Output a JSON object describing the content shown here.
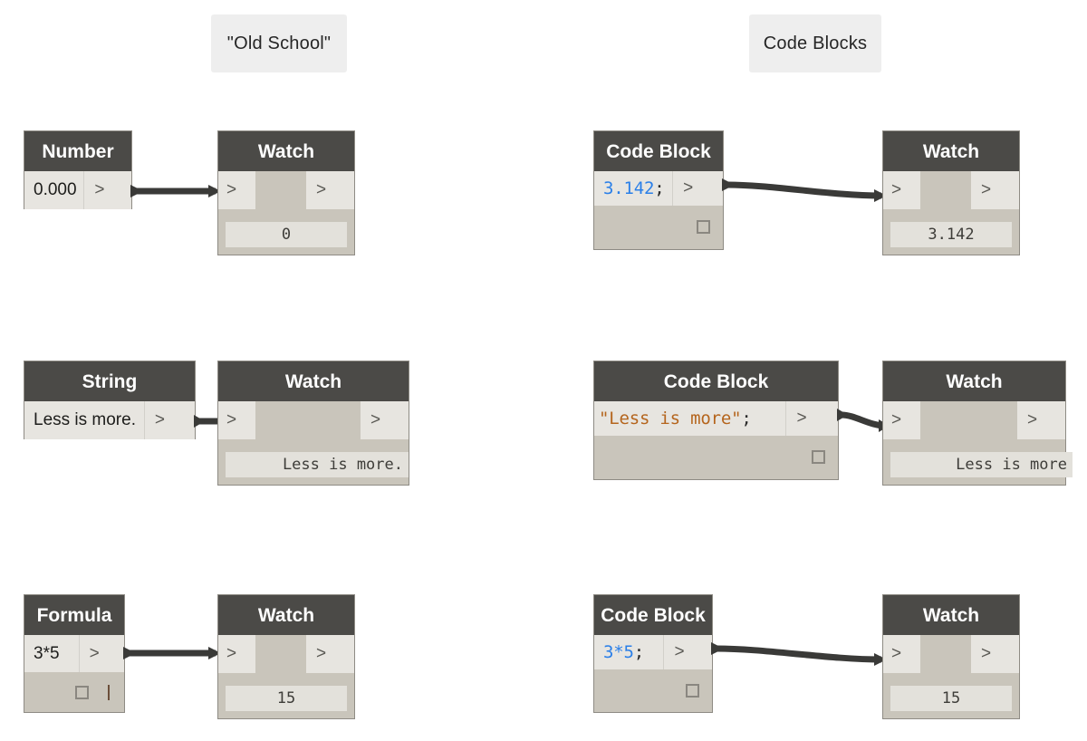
{
  "sections": {
    "left_label": "\"Old School\"",
    "right_label": "Code Blocks"
  },
  "ports": {
    "chevron": ">"
  },
  "rows": [
    {
      "id": "number-row",
      "left": {
        "node_title": "Number",
        "field_value": "0.000",
        "out_port": ">",
        "watch": {
          "title": "Watch",
          "in_port": ">",
          "out_port": ">",
          "value": "0"
        }
      },
      "right": {
        "node_title": "Code Block",
        "code_literal": "3.142",
        "code_punct": ";",
        "out_port": ">",
        "watch": {
          "title": "Watch",
          "in_port": ">",
          "out_port": ">",
          "value": "3.142"
        }
      }
    },
    {
      "id": "string-row",
      "left": {
        "node_title": "String",
        "field_value": "Less is more.",
        "out_port": ">",
        "watch": {
          "title": "Watch",
          "in_port": ">",
          "out_port": ">",
          "value": "Less is more."
        }
      },
      "right": {
        "node_title": "Code Block",
        "code_literal": "\"Less is more\"",
        "code_punct": ";",
        "out_port": ">",
        "watch": {
          "title": "Watch",
          "in_port": ">",
          "out_port": ">",
          "value": "Less is more"
        }
      }
    },
    {
      "id": "formula-row",
      "left": {
        "node_title": "Formula",
        "field_value": "3*5",
        "out_port": ">",
        "watch": {
          "title": "Watch",
          "in_port": ">",
          "out_port": ">",
          "value": "15"
        }
      },
      "right": {
        "node_title": "Code Block",
        "code_literal": "3*5",
        "code_punct": ";",
        "out_port": ">",
        "watch": {
          "title": "Watch",
          "in_port": ">",
          "out_port": ">",
          "value": "15"
        }
      }
    }
  ],
  "colors": {
    "header": "#4b4a47",
    "node_body": "#c9c5bb",
    "port": "#e7e5e0",
    "wire": "#3a3a38",
    "code_number": "#2a7fe8",
    "code_string": "#b5651d",
    "chip_bg": "#eeeeee"
  }
}
